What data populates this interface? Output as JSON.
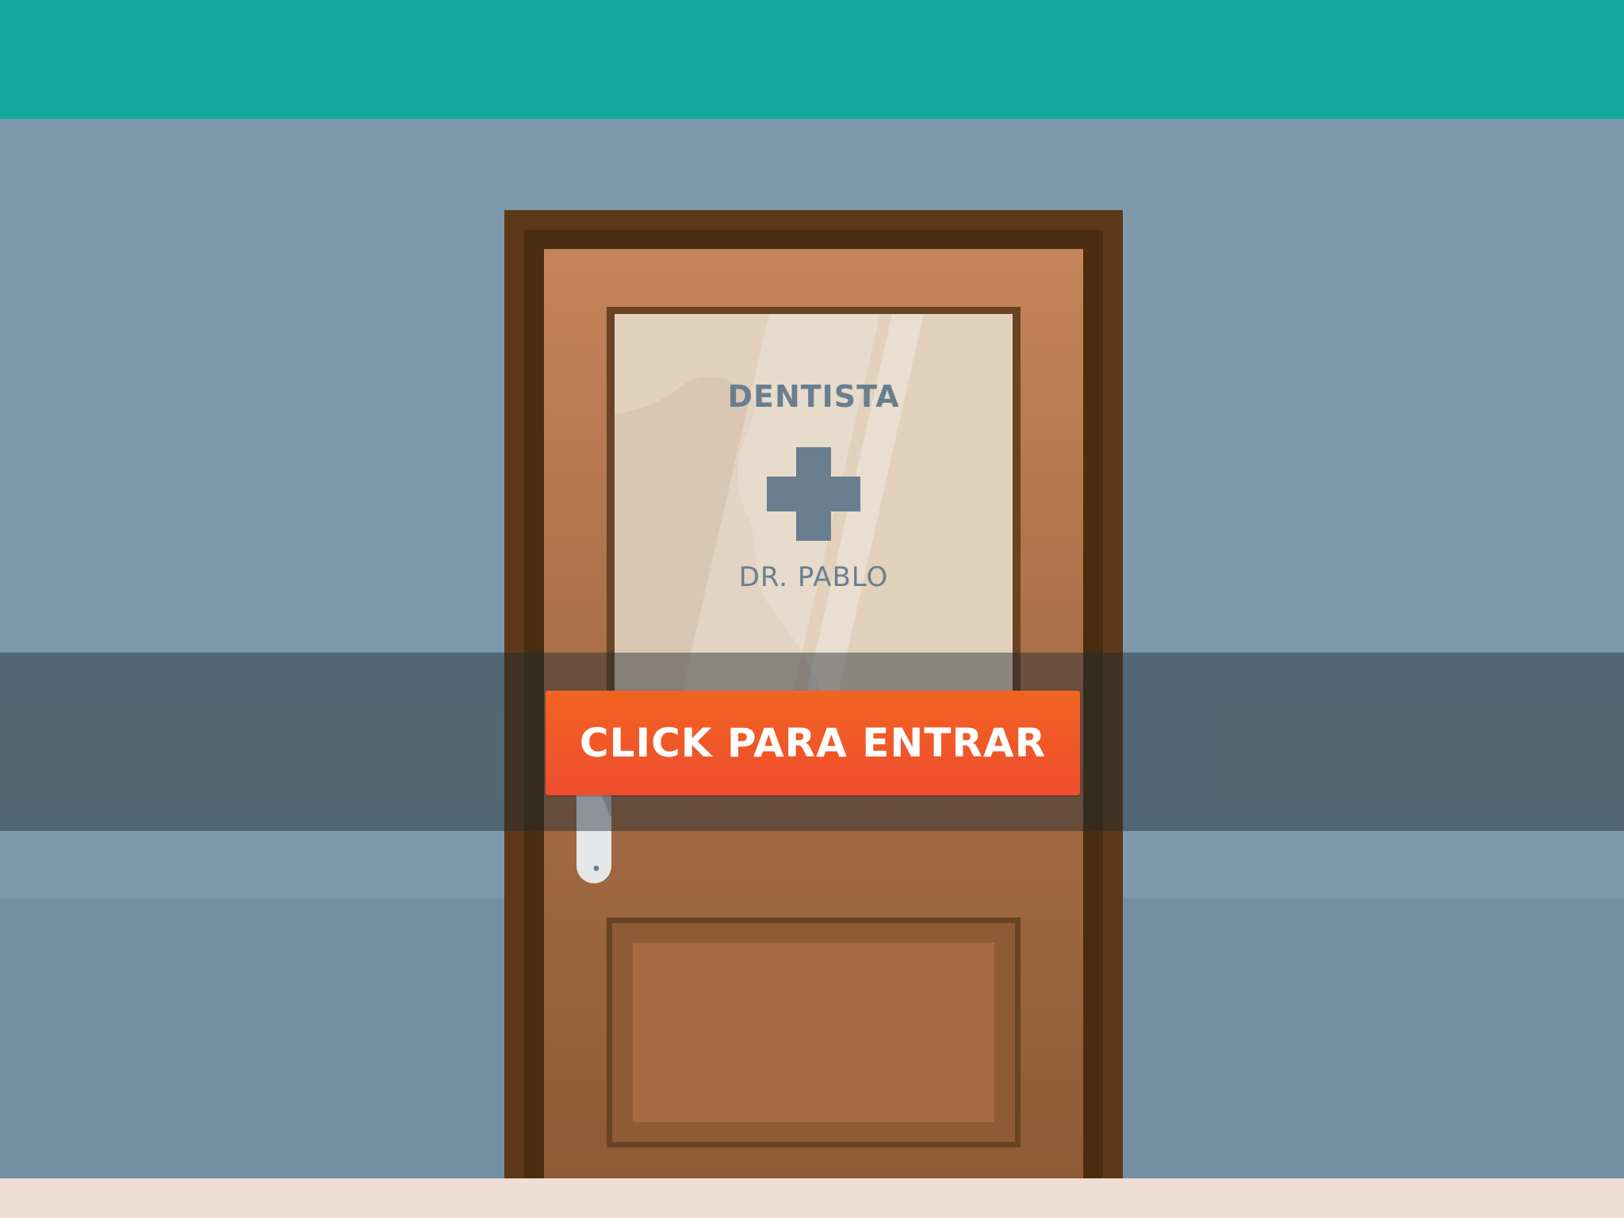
{
  "sign": {
    "title": "DENTISTA",
    "name": "DR. PABLO",
    "icon": "medical-cross-icon"
  },
  "button": {
    "label": "CLICK PARA ENTRAR"
  },
  "colors": {
    "top_bar": "#13a89e",
    "wall": "#7d99ab",
    "wall_lower": "#7390a2",
    "floor": "#f0ddd5",
    "door": "#a96f46",
    "door_frame": "#5d3919",
    "sign_text": "#697f8f",
    "button": "#f26422"
  }
}
